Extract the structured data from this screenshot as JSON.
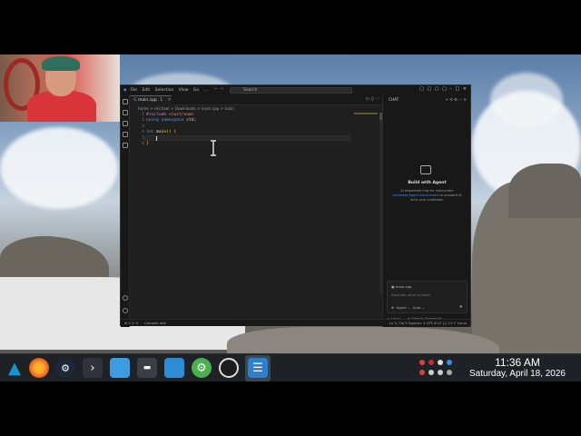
{
  "editor": {
    "menu": [
      "File",
      "Edit",
      "Selection",
      "View",
      "Go",
      "..."
    ],
    "search_placeholder": "Search",
    "tab_label": "main.cpp",
    "tab_badge": "1",
    "breadcrumb": "home > michael > Downloads > main.cpp > main",
    "line_numbers": [
      "1",
      "2",
      "3",
      "4",
      "5",
      "6"
    ],
    "code": {
      "line1_kw": "#include",
      "line1_rest": " <iostream>",
      "line2_kw": "using namespace",
      "line2_rest": " std;",
      "line4_kw": "int",
      "line4_fn": " main",
      "line4_rest": "() {",
      "line6": "}"
    }
  },
  "chat": {
    "header": "CHAT",
    "agent_title": "Build with Agent",
    "agent_desc_1": "AI responses may be inaccurate.",
    "agent_desc_link": "Generate Agent Instructions",
    "agent_desc_2": " to onboard AI onto your codebase.",
    "context_chip": "main.cpp",
    "input_placeholder": "Describe what to build",
    "mode": "Agent",
    "model": "Auto",
    "footer_local": "Local",
    "footer_approvals": "Default Approvals"
  },
  "statusbar": {
    "left": "⊗ 0 ⚠ 0",
    "mid": "Compile info",
    "right": "Ln 5, Col 5   Spaces: 4   UTF-8   LF   {} C++   Linux"
  },
  "taskbar": {
    "time": "11:36 AM",
    "date": "Saturday, April 18, 2026"
  },
  "colors": {
    "accent": "#0078d4",
    "editor_bg": "#1f1f1f",
    "panel_bg": "#181818",
    "taskbar_bg": "#1e2226"
  }
}
